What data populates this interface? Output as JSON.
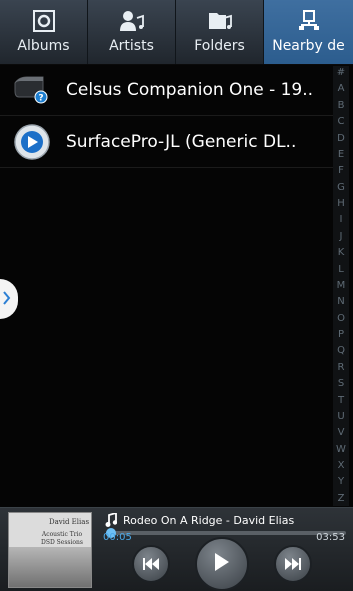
{
  "tabs": [
    {
      "label": "Albums",
      "icon": "album-icon"
    },
    {
      "label": "Artists",
      "icon": "artist-icon"
    },
    {
      "label": "Folders",
      "icon": "folder-music-icon"
    },
    {
      "label": "Nearby de",
      "icon": "nearby-devices-icon",
      "active": true
    }
  ],
  "devices": [
    {
      "name": "Celsus Companion One - 19..",
      "icon": "media-server-icon"
    },
    {
      "name": "SurfacePro-JL (Generic DL..",
      "icon": "windows-media-icon"
    }
  ],
  "index_letters": [
    "#",
    "A",
    "B",
    "C",
    "D",
    "E",
    "F",
    "G",
    "H",
    "I",
    "J",
    "K",
    "L",
    "M",
    "N",
    "O",
    "P",
    "Q",
    "R",
    "S",
    "T",
    "U",
    "V",
    "W",
    "X",
    "Y",
    "Z"
  ],
  "player": {
    "album_artist": "David Elias",
    "album_title_line1": "Acoustic Trio",
    "album_title_line2": "DSD Sessions",
    "song": "Rodeo On A Ridge - David Elias",
    "current_time": "00:05",
    "total_time": "03:53",
    "progress": 0.02
  },
  "colors": {
    "accent": "#4aa8e8",
    "active_tab": "#3f6fa0",
    "background": "#050505"
  }
}
